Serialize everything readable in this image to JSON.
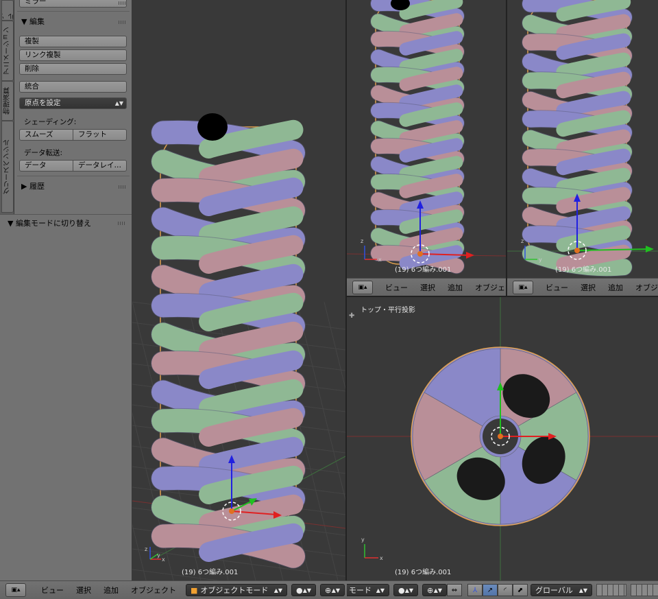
{
  "tabs": [
    "ツール",
    "アニメーション",
    "物理演算",
    "グリースペンシル"
  ],
  "tool_panel": {
    "top_button": "ミラー",
    "edit_section": {
      "title": "編集",
      "buttons": [
        "複製",
        "リンク複製",
        "削除"
      ],
      "join": "統合",
      "set_origin": "原点を設定"
    },
    "shading": {
      "label": "シェーディング:",
      "smooth": "スムーズ",
      "flat": "フラット"
    },
    "data_transfer": {
      "label": "データ転送:",
      "data": "データ",
      "data_layout": "データレイ…"
    },
    "history": "履歴"
  },
  "operator_panel": {
    "title": "編集モードに切り替え"
  },
  "viewports": {
    "left": {
      "object_label": "(19) 6つ編み.001"
    },
    "top_center": {
      "object_label": "(19) 6つ編み.001"
    },
    "top_right": {
      "object_label": "(19) 6つ編み.001"
    },
    "bottom_right": {
      "view_label": "トップ・平行投影",
      "object_label": "(19) 6つ編み.001"
    }
  },
  "header_menus": {
    "view": "ビュー",
    "select": "選択",
    "add": "追加",
    "object": "オブジェクト"
  },
  "mode_dropdown": "オブジェクトモード",
  "mode_dropdown_short": "モード",
  "orientation_dropdown": "グローバル",
  "colors": {
    "purple": "#8a88c8",
    "green": "#8fb894",
    "pink": "#b98f98",
    "outline": "#e0a050",
    "panel": "#727272",
    "viewport": "#393939"
  }
}
